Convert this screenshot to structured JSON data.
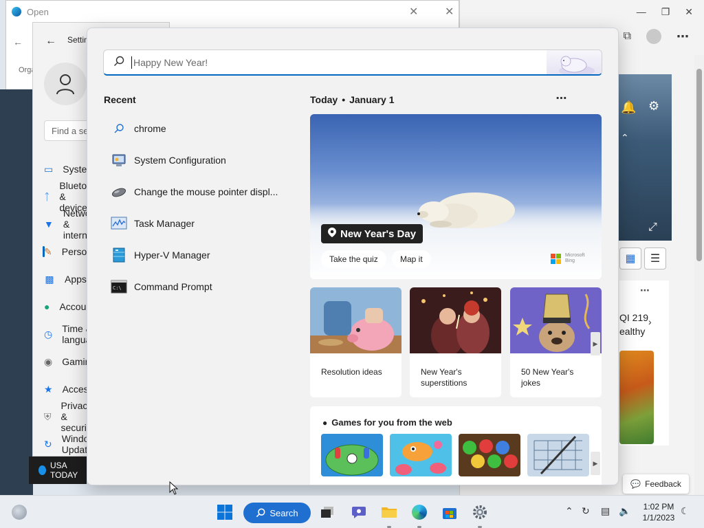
{
  "background": {
    "open_dialog_title": "Open",
    "settings_title": "Settings",
    "settings_search_placeholder": "Find a setting",
    "settings_nav": [
      "System",
      "Bluetooth & devices",
      "Network & internet",
      "Personalization",
      "Apps",
      "Accounts",
      "Time & language",
      "Gaming",
      "Accessibility",
      "Privacy & security",
      "Windows Update"
    ],
    "news_strip": "USA TODAY",
    "browser_card_text": [
      "QI 219",
      "ealthy"
    ],
    "feedback_label": "Feedback",
    "left_glyphs": [
      "Orga"
    ]
  },
  "search": {
    "placeholder": "Happy New Year!",
    "recent_heading": "Recent",
    "recent_items": [
      {
        "label": "chrome",
        "icon": "search-icon"
      },
      {
        "label": "System Configuration",
        "icon": "system-configuration-icon"
      },
      {
        "label": "Change the mouse pointer displ...",
        "icon": "mouse-icon"
      },
      {
        "label": "Task Manager",
        "icon": "task-manager-icon"
      },
      {
        "label": "Hyper-V Manager",
        "icon": "hyper-v-icon"
      },
      {
        "label": "Command Prompt",
        "icon": "command-prompt-icon"
      }
    ],
    "today_label": "Today",
    "date_label": "January 1",
    "hero": {
      "title": "New Year's Day",
      "quiz_button": "Take the quiz",
      "map_button": "Map it",
      "brand": "Microsoft Bing"
    },
    "tiles": [
      {
        "caption": "Resolution ideas"
      },
      {
        "caption": "New Year's superstitions"
      },
      {
        "caption": "50 New Year's jokes"
      }
    ],
    "games_heading": "Games for you from the web"
  },
  "taskbar": {
    "search_label": "Search",
    "time": "1:02 PM",
    "date": "1/1/2023"
  },
  "colors": {
    "accent": "#0067c0",
    "search_pill": "#1f6fd1"
  }
}
